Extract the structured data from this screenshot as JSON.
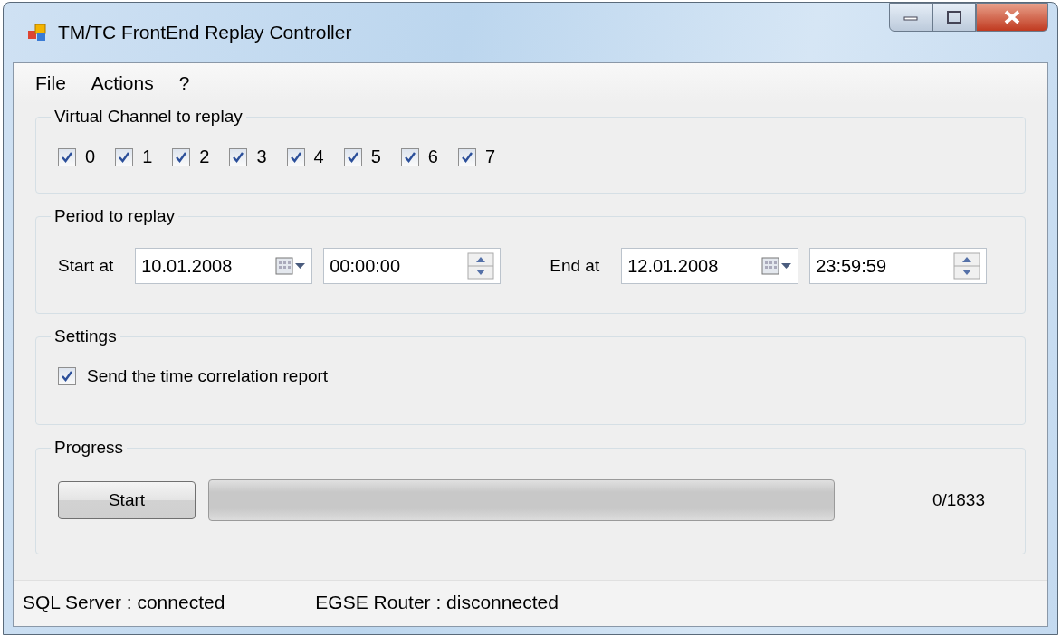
{
  "window": {
    "title": "TM/TC FrontEnd Replay Controller"
  },
  "menu": [
    "File",
    "Actions",
    "?"
  ],
  "channels_group": {
    "title": "Virtual Channel to replay",
    "channels": [
      {
        "label": "0",
        "checked": true
      },
      {
        "label": "1",
        "checked": true
      },
      {
        "label": "2",
        "checked": true
      },
      {
        "label": "3",
        "checked": true
      },
      {
        "label": "4",
        "checked": true
      },
      {
        "label": "5",
        "checked": true
      },
      {
        "label": "6",
        "checked": true
      },
      {
        "label": "7",
        "checked": true
      }
    ]
  },
  "period_group": {
    "title": "Period to replay",
    "start": {
      "label": "Start at",
      "date": "10.01.2008",
      "time": "00:00:00"
    },
    "end": {
      "label": "End at",
      "date": "12.01.2008",
      "time": "23:59:59"
    }
  },
  "settings_group": {
    "title": "Settings",
    "option": {
      "label": "Send the time correlation report",
      "checked": true
    }
  },
  "progress_group": {
    "title": "Progress",
    "button": "Start",
    "level": 0,
    "count": "0/1833"
  },
  "status_bar": [
    "SQL Server : connected",
    "EGSE Router : disconnected"
  ]
}
